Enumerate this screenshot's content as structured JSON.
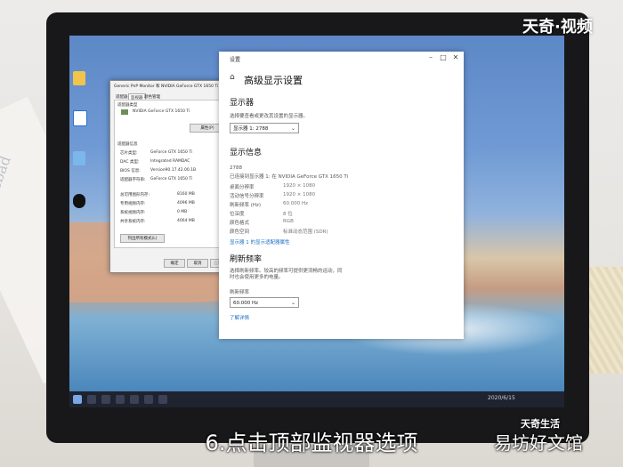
{
  "watermark": {
    "brand": "天奇·视频",
    "bottom_logo": "天奇生活",
    "site": "易坊好文馆"
  },
  "caption": "6.点击顶部监视器选项",
  "paper_text": "ollo bird sbad",
  "desktop_icons": [
    "",
    "",
    "",
    ""
  ],
  "settings": {
    "window_title": "设置",
    "heading": "高级显示设置",
    "section_display": "显示器",
    "choose_display": "选择要查看或更改其设置的显示器。",
    "display_select": "显示器 1: 2788",
    "section_info": "显示信息",
    "display_name": "2788",
    "connected_to": "已连接到显示器 1: 在 NVIDIA GeForce GTX 1650 Ti",
    "rows": [
      {
        "label": "桌面分辨率",
        "value": "1920 × 1080"
      },
      {
        "label": "活动信号分辨率",
        "value": "1920 × 1080"
      },
      {
        "label": "刷新频率 (Hz)",
        "value": "60.000 Hz"
      },
      {
        "label": "位深度",
        "value": "8 位"
      },
      {
        "label": "颜色格式",
        "value": "RGB"
      },
      {
        "label": "颜色空间",
        "value": "标准动态范围 (SDR)"
      }
    ],
    "adapter_link": "显示器 1 的显示适配器属性",
    "section_refresh": "刷新频率",
    "refresh_desc": "选择刷新频率。较高的频率可提供更流畅的运动，同时也会使用更多的电量。",
    "refresh_label": "刷新频率",
    "refresh_select": "60.000 Hz",
    "learn_more": "了解详情"
  },
  "props": {
    "title": "Generic PnP Monitor 和 NVIDIA GeForce GTX 1650 Ti 属性",
    "tabs": [
      "适配器",
      "监视器",
      "颜色管理"
    ],
    "group_adapter": "适配器类型",
    "adapter_name": "NVIDIA GeForce GTX 1650 Ti",
    "properties_button": "属性(P)",
    "group_info": "适配器信息",
    "info_rows": [
      {
        "label": "芯片类型:",
        "value": "GeForce GTX 1650 Ti"
      },
      {
        "label": "DAC 类型:",
        "value": "Integrated RAMDAC"
      },
      {
        "label": "BIOS 信息:",
        "value": "Version90.17.42.00.1B"
      },
      {
        "label": "适配器字符串:",
        "value": "GeForce GTX 1650 Ti"
      }
    ],
    "mem_rows": [
      {
        "label": "总可用图形内存:",
        "value": "8160 MB"
      },
      {
        "label": "专用视频内存:",
        "value": "4096 MB"
      },
      {
        "label": "系统视频内存:",
        "value": "0 MB"
      },
      {
        "label": "共享系统内存:",
        "value": "4064 MB"
      }
    ],
    "list_modes_button": "列出所有模式(L)",
    "ok_button": "确定",
    "cancel_button": "取消",
    "apply_button": "应用(A)"
  },
  "taskbar": {
    "tray_text": "2020/6/15"
  }
}
